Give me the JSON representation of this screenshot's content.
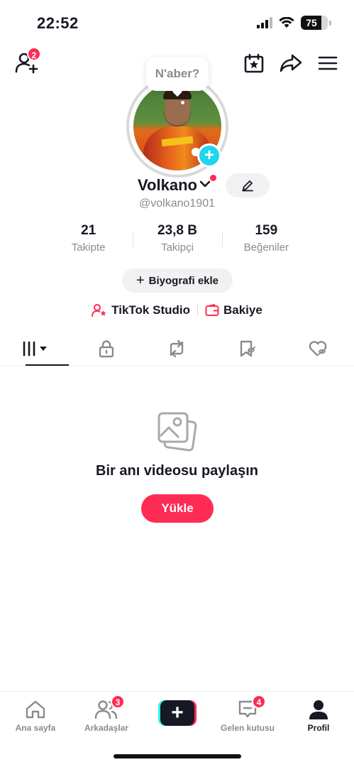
{
  "status_bar": {
    "time": "22:52",
    "battery": "75",
    "battery_level": 0.75
  },
  "header": {
    "add_friends_badge": "2"
  },
  "profile": {
    "note_bubble": "N'aber?",
    "username": "Volkano",
    "handle": "@volkano1901",
    "stats": [
      {
        "value": "21",
        "label": "Takipte"
      },
      {
        "value": "23,8 B",
        "label": "Takipçi"
      },
      {
        "value": "159",
        "label": "Beğeniler"
      }
    ],
    "bio_button": "Biyografi ekle",
    "links": {
      "studio": "TikTok Studio",
      "balance": "Bakiye"
    }
  },
  "empty_state": {
    "title": "Bir anı videosu paylaşın",
    "upload_button": "Yükle"
  },
  "bottom_nav": {
    "home": "Ana sayfa",
    "friends": "Arkadaşlar",
    "friends_badge": "3",
    "inbox": "Gelen kutusu",
    "inbox_badge": "4",
    "profile": "Profil"
  },
  "colors": {
    "accent": "#fe2c55",
    "cyan": "#20d5ec",
    "muted": "#8a8b91",
    "text": "#161823"
  }
}
